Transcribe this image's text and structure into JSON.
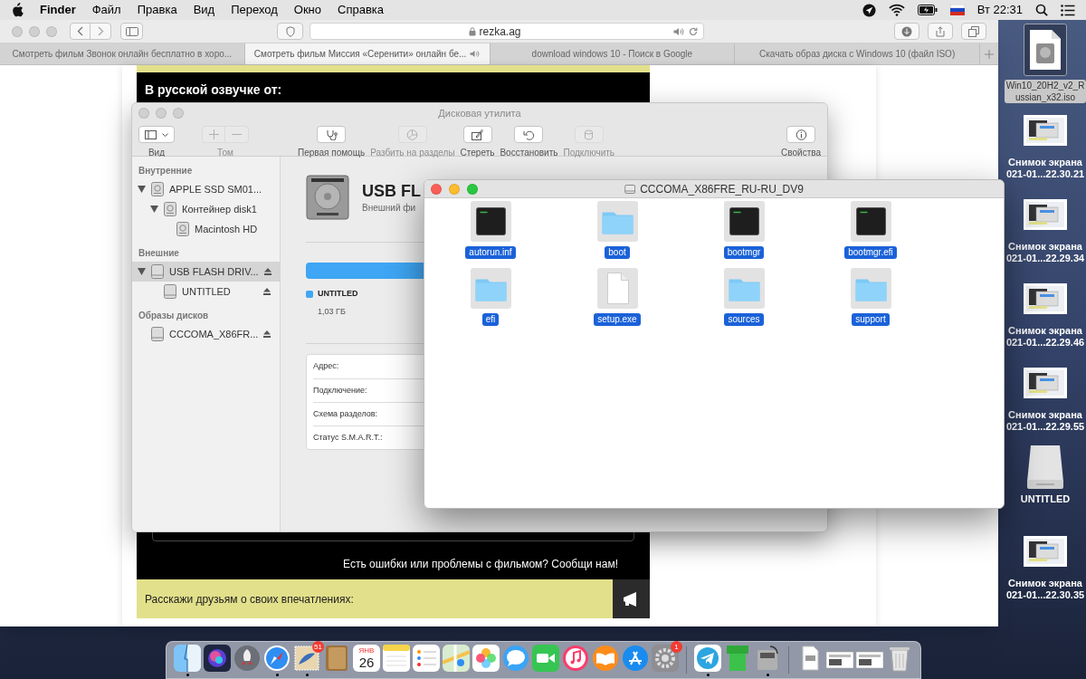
{
  "menu_bar": {
    "app": "Finder",
    "items": [
      "Файл",
      "Правка",
      "Вид",
      "Переход",
      "Окно",
      "Справка"
    ],
    "clock": "Вт 22:31"
  },
  "browser": {
    "address": "rezka.ag",
    "tabs": [
      {
        "title": "Смотреть фильм Звонок онлайн бесплатно в хоро...",
        "selected": false,
        "audio": false
      },
      {
        "title": "Смотреть фильм Миссия «Серенити» онлайн бе...",
        "selected": true,
        "audio": true
      },
      {
        "title": "download windows 10 - Поиск в Google",
        "selected": false,
        "audio": false
      },
      {
        "title": "Скачать образ диска с Windows 10 (файл ISO)",
        "selected": false,
        "audio": false
      }
    ],
    "page": {
      "dubbing_heading": "В русской озвучке от:",
      "report_text": "Есть ошибки или проблемы с фильмом? Сообщи нам!",
      "share_text": "Расскажи друзьям о своих впечатлениях:"
    }
  },
  "disk_utility": {
    "title": "Дисковая утилита",
    "toolbar": [
      {
        "kind": "view",
        "label": "Вид",
        "disabled": false
      },
      {
        "kind": "volume",
        "label": "Том",
        "disabled": true
      },
      {
        "kind": "first_aid",
        "label": "Первая помощь",
        "disabled": false
      },
      {
        "kind": "partition",
        "label": "Разбить на разделы",
        "disabled": true
      },
      {
        "kind": "erase",
        "label": "Стереть",
        "disabled": false
      },
      {
        "kind": "restore",
        "label": "Восстановить",
        "disabled": false
      },
      {
        "kind": "mount",
        "label": "Подключить",
        "disabled": true
      },
      {
        "kind": "info",
        "label": "Свойства",
        "disabled": false
      }
    ],
    "sidebar": [
      {
        "heading": "Внутренние",
        "items": [
          {
            "label": "APPLE SSD SM01...",
            "kind": "internal",
            "expanded": true,
            "selected": false,
            "eject": false,
            "children": [
              {
                "label": "Контейнер disk1",
                "kind": "internal",
                "expanded": true,
                "selected": false,
                "eject": false,
                "children": [
                  {
                    "label": "Macintosh HD",
                    "kind": "internal",
                    "selected": false,
                    "eject": false
                  }
                ]
              }
            ]
          }
        ]
      },
      {
        "heading": "Внешние",
        "items": [
          {
            "label": "USB FLASH DRIV...",
            "kind": "external",
            "expanded": true,
            "selected": true,
            "eject": true,
            "children": [
              {
                "label": "UNTITLED",
                "kind": "external",
                "selected": false,
                "eject": true
              }
            ]
          }
        ]
      },
      {
        "heading": "Образы дисков",
        "items": [
          {
            "label": "CCCOMA_X86FR...",
            "kind": "external",
            "selected": false,
            "eject": true
          }
        ]
      }
    ],
    "device": {
      "name": "USB FL",
      "subtitle": "Внешний фи",
      "volume": {
        "name": "UNTITLED",
        "size": "1,03 ГБ",
        "color": "#3ea6f4"
      },
      "info_labels": [
        "Адрес:",
        "Подключение:",
        "Схема разделов:",
        "Статус S.M.A.R.T.:"
      ]
    }
  },
  "finder_window": {
    "title": "CCCOMA_X86FRE_RU-RU_DV9",
    "files": [
      {
        "name": "autorun.inf",
        "kind": "exec",
        "selected": true
      },
      {
        "name": "boot",
        "kind": "folder",
        "selected": true
      },
      {
        "name": "bootmgr",
        "kind": "exec",
        "selected": true
      },
      {
        "name": "bootmgr.efi",
        "kind": "exec",
        "selected": true
      },
      {
        "name": "efi",
        "kind": "folder",
        "selected": true
      },
      {
        "name": "setup.exe",
        "kind": "document",
        "selected": true
      },
      {
        "name": "sources",
        "kind": "folder",
        "selected": true
      },
      {
        "name": "support",
        "kind": "folder",
        "selected": true
      }
    ]
  },
  "desktop_icons": [
    {
      "kind": "disk_image",
      "lines": [
        "Win10_20H2_v2_R",
        "ussian_x32.iso"
      ],
      "selected": true
    },
    {
      "kind": "screenshot",
      "lines": [
        "Снимок экрана",
        "021-01...22.30.21"
      ],
      "selected": false
    },
    {
      "kind": "screenshot",
      "lines": [
        "Снимок экрана",
        "021-01...22.29.34"
      ],
      "selected": false
    },
    {
      "kind": "screenshot",
      "lines": [
        "Снимок экрана",
        "021-01...22.29.46"
      ],
      "selected": false
    },
    {
      "kind": "screenshot",
      "lines": [
        "Снимок экрана",
        "021-01...22.29.55"
      ],
      "selected": false
    },
    {
      "kind": "drive",
      "lines": [
        "UNTITLED"
      ],
      "selected": false
    },
    {
      "kind": "screenshot",
      "lines": [
        "Снимок экрана",
        "021-01...22.30.35"
      ],
      "selected": false
    }
  ],
  "dock": {
    "apps": [
      {
        "kind": "finder",
        "running": true
      },
      {
        "kind": "siri",
        "running": false
      },
      {
        "kind": "launchpad",
        "running": false
      },
      {
        "kind": "safari",
        "running": true
      },
      {
        "kind": "mail",
        "running": true,
        "badge": "51"
      },
      {
        "kind": "contacts",
        "running": false
      },
      {
        "kind": "calendar",
        "running": false,
        "month": "ЯНВ",
        "day": "26"
      },
      {
        "kind": "notes",
        "running": false
      },
      {
        "kind": "reminders",
        "running": false
      },
      {
        "kind": "maps",
        "running": false
      },
      {
        "kind": "photos",
        "running": false
      },
      {
        "kind": "messages",
        "running": false
      },
      {
        "kind": "facetime",
        "running": false
      },
      {
        "kind": "music",
        "running": false
      },
      {
        "kind": "books",
        "running": false
      },
      {
        "kind": "appstore",
        "running": false
      },
      {
        "kind": "preferences",
        "running": false,
        "badge": "1"
      }
    ],
    "utilities": [
      {
        "kind": "telegram",
        "running": true
      },
      {
        "kind": "pipe",
        "running": false
      },
      {
        "kind": "diskutility",
        "running": true
      }
    ],
    "stacks": [
      {
        "kind": "downloads",
        "running": false
      },
      {
        "kind": "screenshots",
        "running": false
      },
      {
        "kind": "screenshots",
        "running": false
      },
      {
        "kind": "trash",
        "running": false
      }
    ]
  }
}
